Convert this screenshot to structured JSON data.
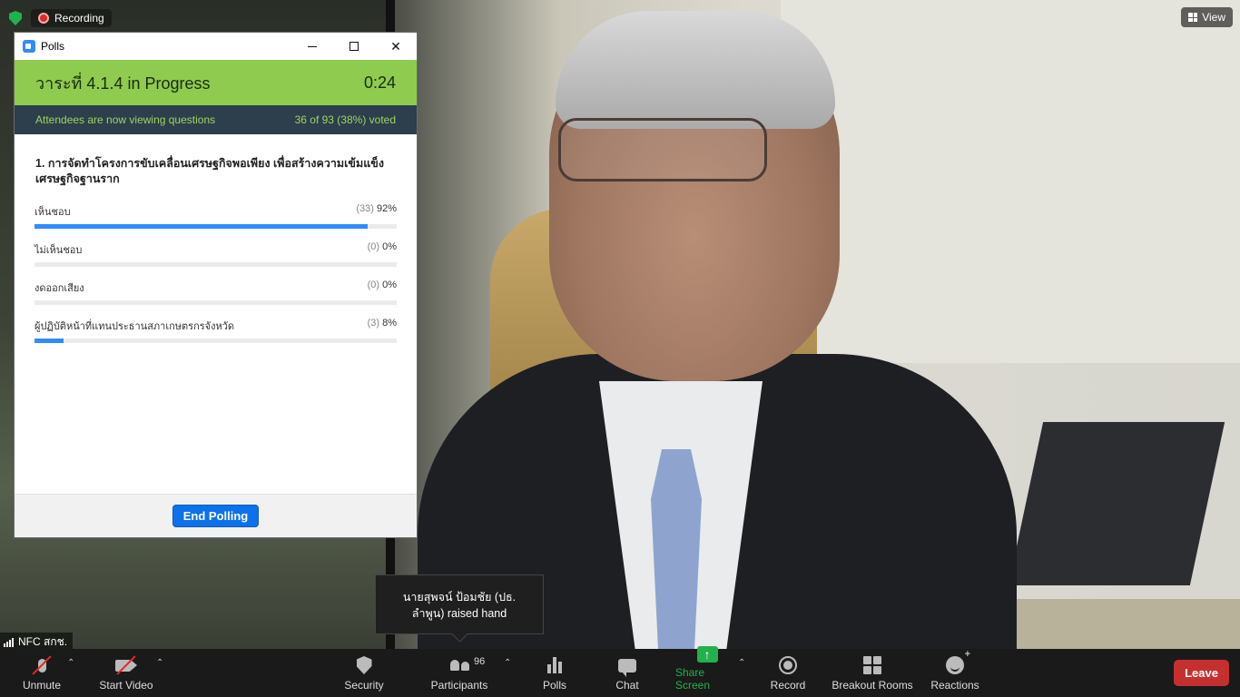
{
  "overlay": {
    "recording_label": "Recording",
    "view_label": "View",
    "participant_name": "NFC สกช."
  },
  "polls_window": {
    "title": "Polls",
    "status_title": "วาระที่ 4.1.4  in Progress",
    "timer": "0:24",
    "info_left": "Attendees are now viewing questions",
    "info_right": "36 of 93 (38%) voted",
    "question": "1. การจัดทำโครงการขับเคลื่อนเศรษฐกิจพอเพียง เพื่อสร้างความเข้มแข็งเศรษฐกิจฐานราก",
    "options": [
      {
        "label": "เห็นชอบ",
        "count": "(33)",
        "pct": "92%",
        "fraction": 0.92
      },
      {
        "label": "ไม่เห็นชอบ",
        "count": "(0)",
        "pct": "0%",
        "fraction": 0
      },
      {
        "label": "งดออกเสียง",
        "count": "(0)",
        "pct": "0%",
        "fraction": 0
      },
      {
        "label": "ผู้ปฏิบัติหน้าที่แทนประธานสภาเกษตรกรจังหวัด",
        "count": "(3)",
        "pct": "8%",
        "fraction": 0.08
      }
    ],
    "end_button": "End Polling"
  },
  "toast": {
    "line1": "นายสุพจน์ ป้อมชัย (ปธ.",
    "line2": "ลำพูน) raised hand"
  },
  "toolbar": {
    "unmute": "Unmute",
    "start_video": "Start Video",
    "security": "Security",
    "participants": "Participants",
    "participants_count": "96",
    "polls": "Polls",
    "chat": "Chat",
    "share_screen": "Share Screen",
    "record": "Record",
    "breakout_rooms": "Breakout Rooms",
    "reactions": "Reactions",
    "leave": "Leave"
  },
  "colors": {
    "poll_status_bg": "#8fcb4f",
    "poll_info_bg": "#2d3e4d",
    "poll_info_text": "#9fd35f",
    "bar_fill": "#2d8cff",
    "end_button": "#0e71eb",
    "share_screen": "#22b14c",
    "leave": "#c62f2f"
  }
}
